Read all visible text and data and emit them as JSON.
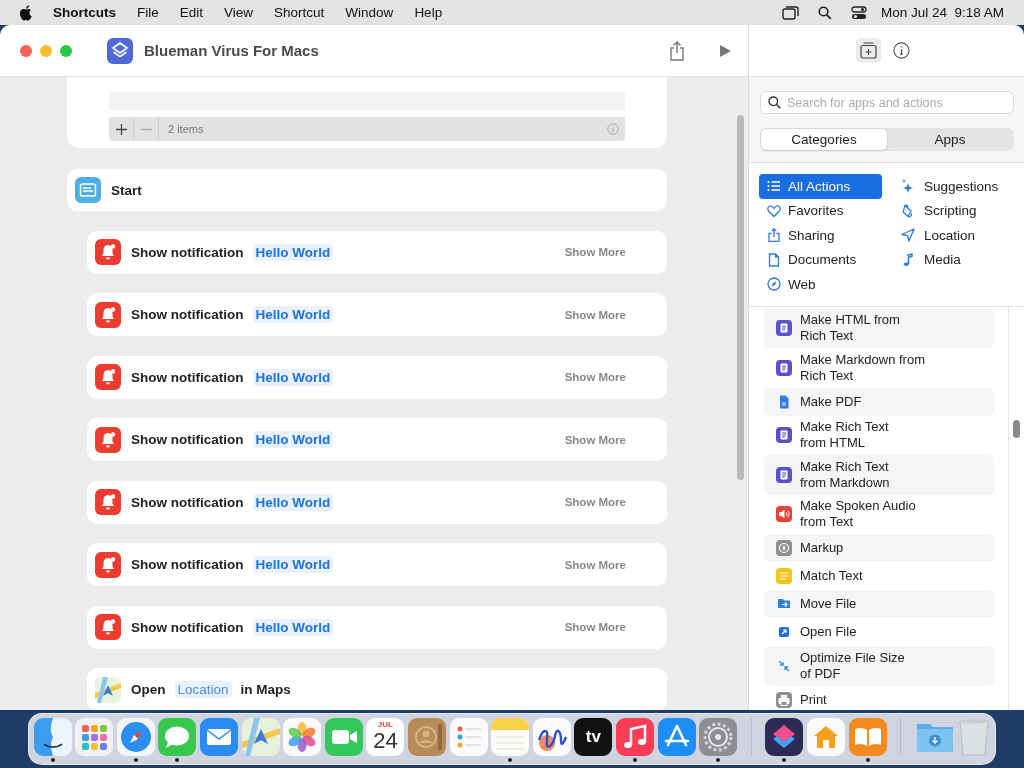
{
  "menu_bar": {
    "app_name": "Shortcuts",
    "menus": [
      "File",
      "Edit",
      "View",
      "Shortcut",
      "Window",
      "Help"
    ],
    "clock": "Mon Jul 24  9:18 AM"
  },
  "window": {
    "title": "Blueman Virus For Macs"
  },
  "list_editor": {
    "count": "2 items"
  },
  "actions": [
    {
      "kind": "start",
      "label": "Start"
    },
    {
      "kind": "notification",
      "label": "Show notification",
      "parameter": "Hello World",
      "more": "Show More"
    },
    {
      "kind": "notification",
      "label": "Show notification",
      "parameter": "Hello World",
      "more": "Show More"
    },
    {
      "kind": "notification",
      "label": "Show notification",
      "parameter": "Hello World",
      "more": "Show More"
    },
    {
      "kind": "notification",
      "label": "Show notification",
      "parameter": "Hello World",
      "more": "Show More"
    },
    {
      "kind": "notification",
      "label": "Show notification",
      "parameter": "Hello World",
      "more": "Show More"
    },
    {
      "kind": "notification",
      "label": "Show notification",
      "parameter": "Hello World",
      "more": "Show More"
    },
    {
      "kind": "notification",
      "label": "Show notification",
      "parameter": "Hello World",
      "more": "Show More"
    },
    {
      "kind": "maps",
      "label": "Open",
      "parameter": "Location",
      "suffix": "in Maps"
    }
  ],
  "sidebar": {
    "search": {
      "placeholder": "Search for apps and actions"
    },
    "segments": [
      {
        "label": "Categories",
        "selected": true
      },
      {
        "label": "Apps",
        "selected": false
      }
    ],
    "category_columns": [
      [
        {
          "kind": "list",
          "label": "All Actions",
          "selected": true
        },
        {
          "kind": "heart",
          "label": "Favorites",
          "selected": false
        },
        {
          "kind": "share",
          "label": "Sharing",
          "selected": false
        },
        {
          "kind": "document",
          "label": "Documents",
          "selected": false
        },
        {
          "kind": "compass",
          "label": "Web",
          "selected": false
        }
      ],
      [
        {
          "kind": "sparkle",
          "label": "Suggestions",
          "selected": false
        },
        {
          "kind": "scroll",
          "label": "Scripting",
          "selected": false
        },
        {
          "kind": "arrow",
          "label": "Location",
          "selected": false
        },
        {
          "kind": "note",
          "label": "Media",
          "selected": false
        }
      ]
    ],
    "actions": [
      {
        "kind": "text",
        "label": "Make HTML from\nRich Text",
        "color": "#5b50c8"
      },
      {
        "kind": "text",
        "label": "Make Markdown from\nRich Text",
        "color": "#5b50c8"
      },
      {
        "kind": "pdf",
        "label": "Make PDF",
        "color": "#2f7ee0"
      },
      {
        "kind": "text",
        "label": "Make Rich Text\nfrom HTML",
        "color": "#5b50c8"
      },
      {
        "kind": "text",
        "label": "Make Rich Text\nfrom Markdown",
        "color": "#5b50c8"
      },
      {
        "kind": "audio",
        "label": "Make Spoken Audio\nfrom Text",
        "color": "#e8413a"
      },
      {
        "kind": "markup",
        "label": "Markup",
        "color": "#8e8e93"
      },
      {
        "kind": "match",
        "label": "Match Text",
        "color": "#f5c518"
      },
      {
        "kind": "move",
        "label": "Move File",
        "color": "#2f7ee0"
      },
      {
        "kind": "open",
        "label": "Open File",
        "color": "#1f6fd6"
      },
      {
        "kind": "optimize",
        "label": "Optimize File Size\nof PDF",
        "color": "#3a8ee6"
      },
      {
        "kind": "print",
        "label": "Print",
        "color": "#8e8e93"
      }
    ]
  },
  "dock": [
    {
      "kind": "finder",
      "running": true
    },
    {
      "kind": "launchpad",
      "running": false
    },
    {
      "kind": "safari",
      "running": true
    },
    {
      "kind": "messages",
      "running": true
    },
    {
      "kind": "mail",
      "running": false
    },
    {
      "kind": "maps",
      "running": false
    },
    {
      "kind": "photos",
      "running": false
    },
    {
      "kind": "facetime",
      "running": false
    },
    {
      "kind": "calendar",
      "running": false,
      "month": "JUL",
      "day": "24"
    },
    {
      "kind": "contacts",
      "running": false
    },
    {
      "kind": "reminders",
      "running": false
    },
    {
      "kind": "notes",
      "running": true
    },
    {
      "kind": "freeform",
      "running": false
    },
    {
      "kind": "tv",
      "running": false,
      "label": "tv"
    },
    {
      "kind": "music",
      "running": true
    },
    {
      "kind": "appstore",
      "running": false
    },
    {
      "kind": "settings",
      "running": true
    },
    {
      "kind": "separator"
    },
    {
      "kind": "shortcuts",
      "running": true
    },
    {
      "kind": "home",
      "running": false
    },
    {
      "kind": "books",
      "running": true
    },
    {
      "kind": "separator"
    },
    {
      "kind": "downloads",
      "running": false
    },
    {
      "kind": "trash",
      "running": false
    }
  ]
}
